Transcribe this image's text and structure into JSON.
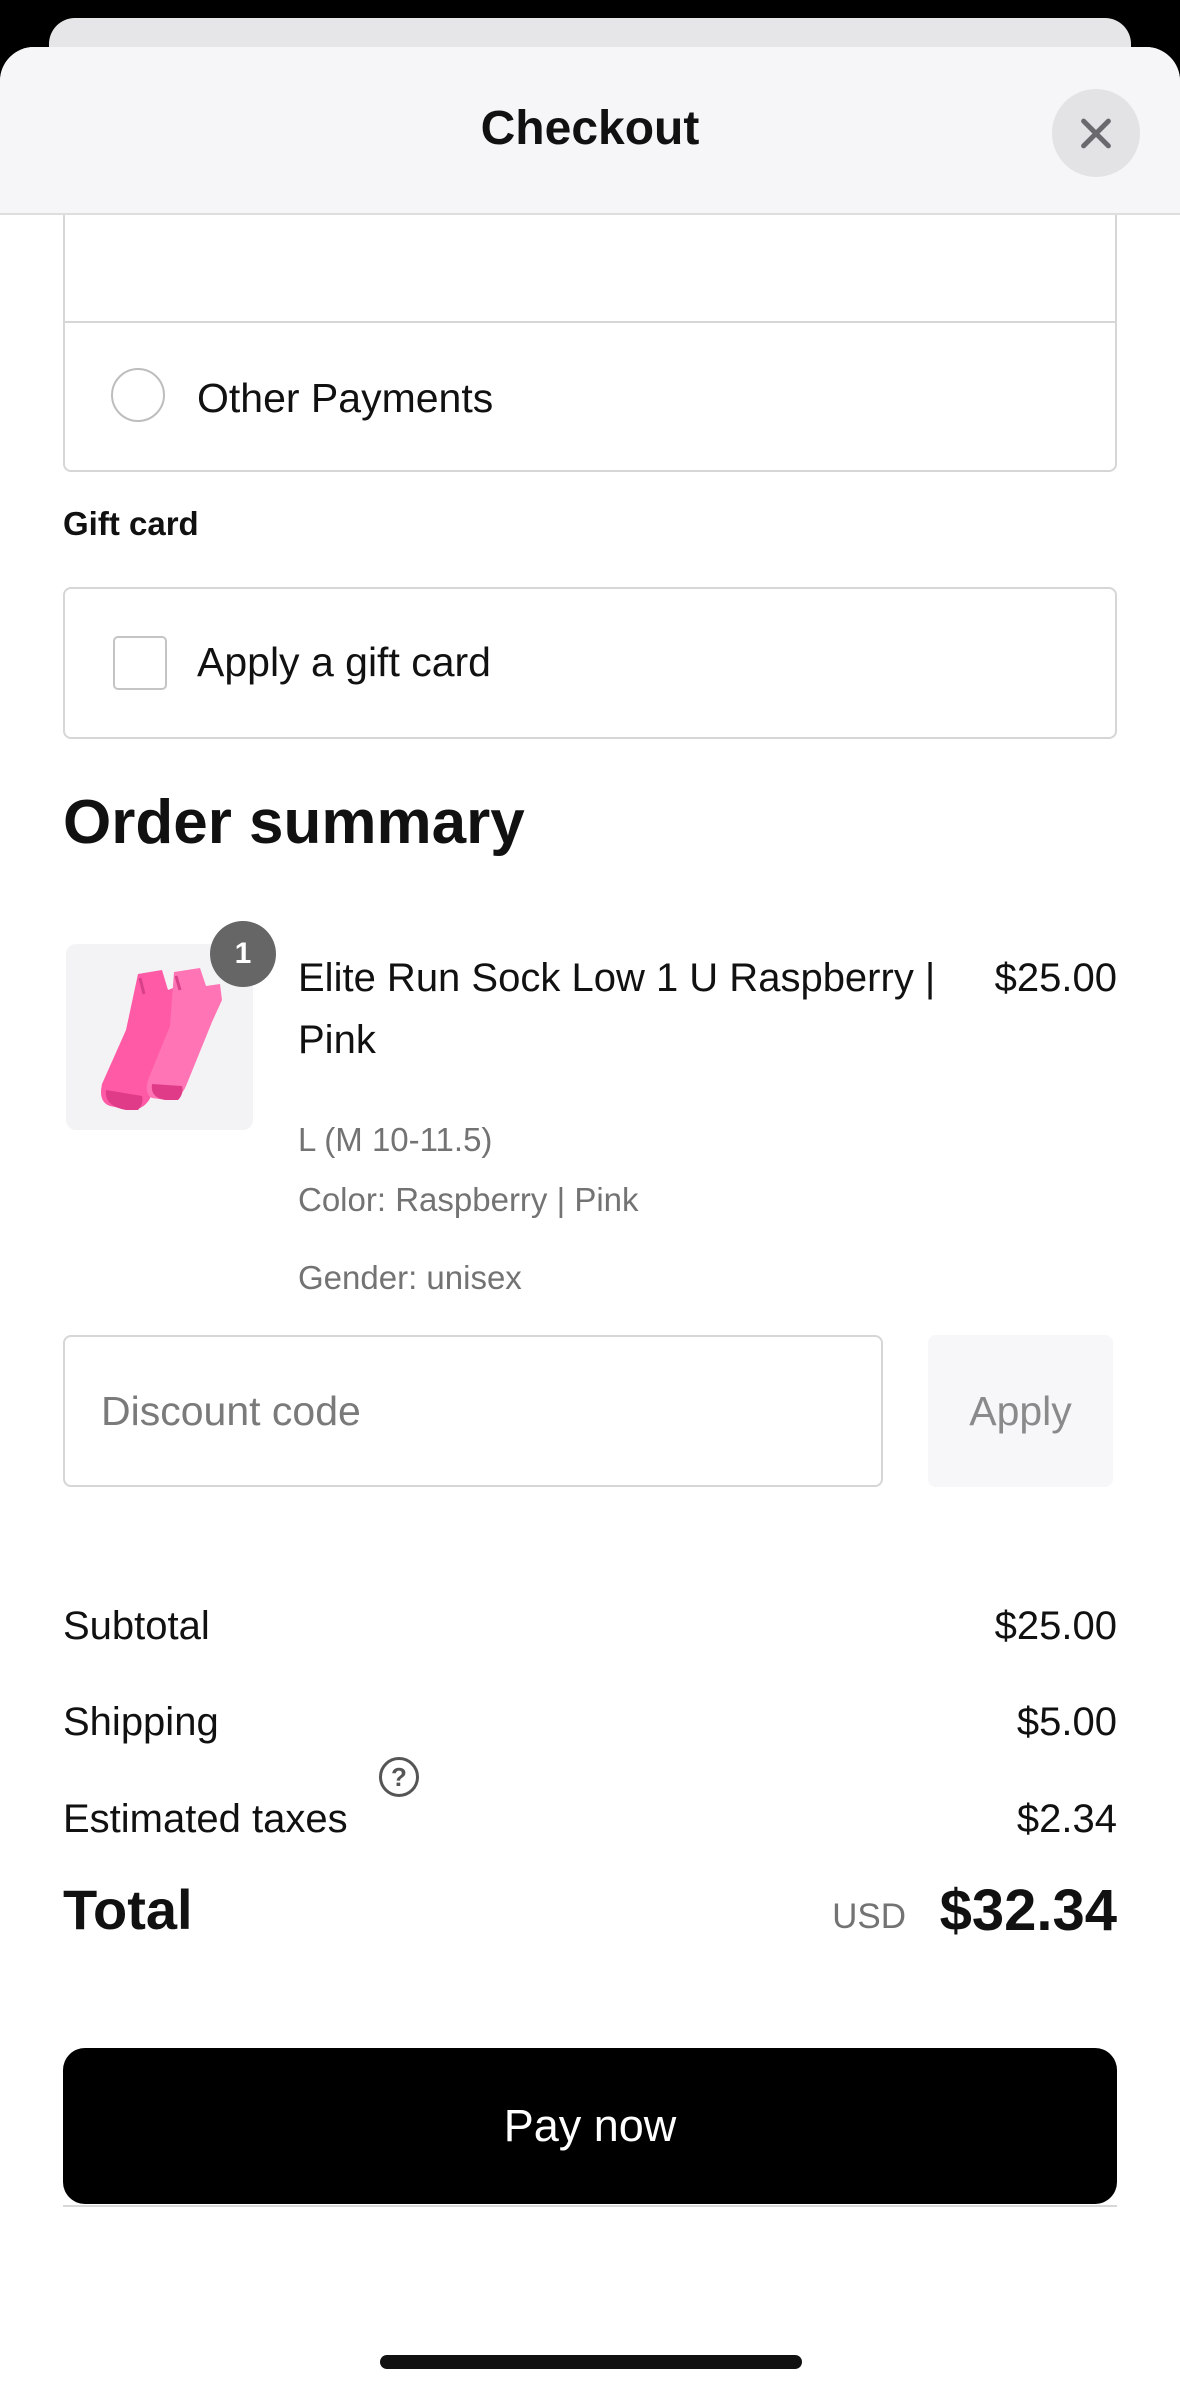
{
  "header": {
    "title": "Checkout"
  },
  "payment": {
    "other_label": "Other Payments"
  },
  "gift_card": {
    "section_label": "Gift card",
    "checkbox_label": "Apply a gift card"
  },
  "order_summary": {
    "title": "Order summary",
    "item": {
      "quantity": "1",
      "name": "Elite Run Sock Low 1 U Raspberry | Pink",
      "price": "$25.00",
      "size": "L (M 10-11.5)",
      "color": "Color: Raspberry | Pink",
      "gender": "Gender: unisex"
    }
  },
  "discount": {
    "placeholder": "Discount code",
    "apply_label": "Apply"
  },
  "totals": {
    "subtotal_label": "Subtotal",
    "subtotal_value": "$25.00",
    "shipping_label": "Shipping",
    "shipping_value": "$5.00",
    "taxes_label": "Estimated taxes",
    "taxes_value": "$2.34",
    "total_label": "Total",
    "currency": "USD",
    "total_value": "$32.34"
  },
  "actions": {
    "pay_label": "Pay now"
  },
  "icons": {
    "close": "close-icon",
    "help": "question-circle-icon",
    "product": "sock-image"
  },
  "colors": {
    "primary_button": "#000000",
    "sock_pink": "#ff5aa5",
    "border": "#d6d6d6"
  }
}
